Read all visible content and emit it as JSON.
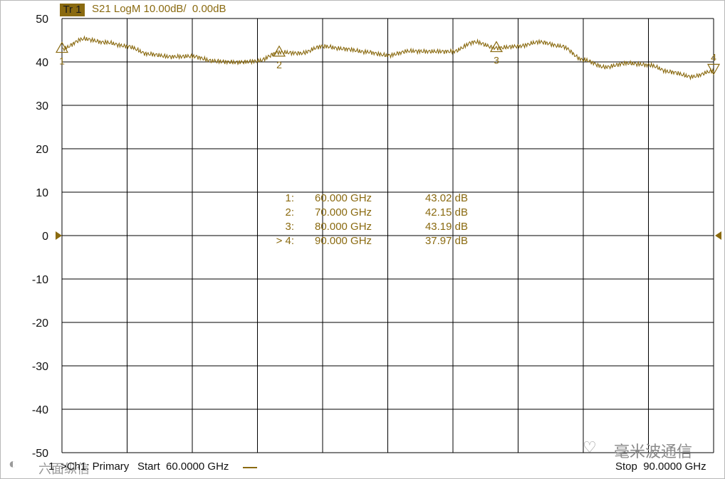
{
  "header": {
    "trace_badge": "Tr 1",
    "trace_desc": "S21 LogM 10.00dB/  0.00dB"
  },
  "footer": {
    "channel_index": "1",
    "channel_label": ">Ch1: Primary",
    "start": "Start  60.0000 GHz",
    "stop": "Stop  90.0000 GHz"
  },
  "watermarks": {
    "left": "六面纵信",
    "right": "毫米波通信"
  },
  "colors": {
    "trace": "#8a6a10",
    "grid": "#000000",
    "axis_text": "#111111"
  },
  "chart_data": {
    "type": "line",
    "title": "S21 LogM 10.00dB/  0.00dB",
    "xlabel": "",
    "ylabel": "",
    "xlim": [
      60,
      90
    ],
    "ylim": [
      -50,
      50
    ],
    "yticks": [
      50,
      40,
      30,
      20,
      10,
      0,
      -10,
      -20,
      -30,
      -40,
      -50
    ],
    "x_unit": "GHz",
    "y_unit": "dB",
    "grid": true,
    "reference_level": 0,
    "series": [
      {
        "x": [
          60,
          61,
          62,
          63,
          64,
          65,
          66,
          67,
          68,
          69,
          70,
          71,
          72,
          73,
          74,
          75,
          76,
          77,
          78,
          79,
          80,
          81,
          82,
          83,
          84,
          85,
          86,
          87,
          88,
          89,
          90
        ],
        "y": [
          43.0,
          45.3,
          44.5,
          43.6,
          41.8,
          41.2,
          41.3,
          40.2,
          39.9,
          40.2,
          42.2,
          42.0,
          43.6,
          43.0,
          42.3,
          41.5,
          42.5,
          42.4,
          42.4,
          44.6,
          43.2,
          43.6,
          44.6,
          43.6,
          40.5,
          38.8,
          39.7,
          39.3,
          37.7,
          36.6,
          37.9
        ]
      }
    ],
    "markers": [
      {
        "label": "1",
        "readout_index": "1:",
        "freq": "60.000  GHz",
        "value": "43.02 dB",
        "x": 60,
        "y": 43.02,
        "direction": "up"
      },
      {
        "label": "2",
        "readout_index": "2:",
        "freq": "70.000  GHz",
        "value": "42.15 dB",
        "x": 70,
        "y": 42.15,
        "direction": "up"
      },
      {
        "label": "3",
        "readout_index": "3:",
        "freq": "80.000  GHz",
        "value": "43.19 dB",
        "x": 80,
        "y": 43.19,
        "direction": "up"
      },
      {
        "label": "4",
        "readout_index": "> 4:",
        "freq": "90.000  GHz",
        "value": "37.97 dB",
        "x": 90,
        "y": 37.97,
        "direction": "down"
      }
    ]
  }
}
